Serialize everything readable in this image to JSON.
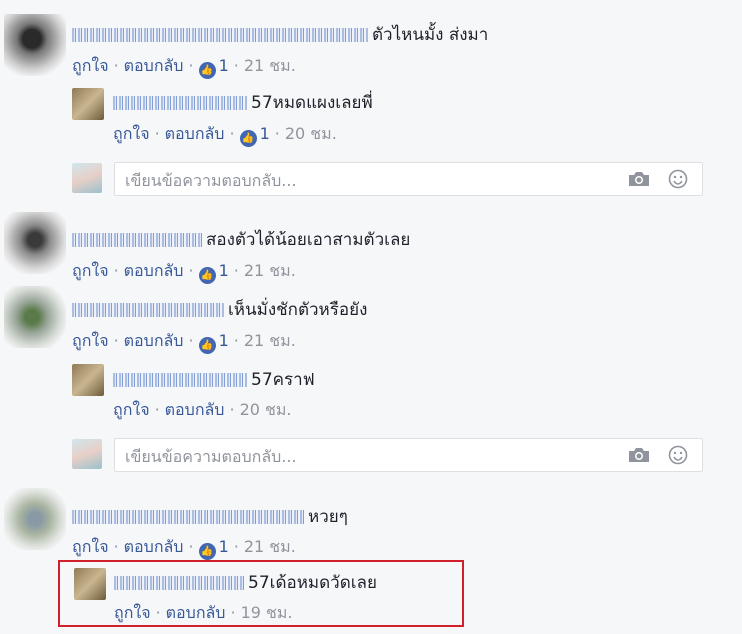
{
  "labels": {
    "like": "ถูกใจ",
    "reply": "ตอบกลับ",
    "separator": "·",
    "like_icon": "thumbs-up-icon"
  },
  "colors": {
    "link": "#385898",
    "meta": "#90949c",
    "like_badge": "#4267b2",
    "highlight": "#d0202c"
  },
  "comments": [
    {
      "text": "ตัวไหนมั้ง ส่งมา",
      "likes": "1",
      "time": "21 ชม."
    },
    {
      "text": "57หมดแผงเลยพี่",
      "likes": "1",
      "time": "20 ชม."
    },
    {
      "text": "สองตัวได้น้อยเอาสามตัวเลย",
      "likes": "1",
      "time": "21 ชม."
    },
    {
      "text": "เห็นมั่งชักตัวหรือยัง",
      "likes": "1",
      "time": "21 ชม."
    },
    {
      "text": "57คราฟ",
      "time": "20 ชม."
    },
    {
      "text": "หวยๆ",
      "likes": "1",
      "time": "21 ชม."
    },
    {
      "text": "57เด้อหมดวัดเลย",
      "time": "19 ชม."
    }
  ],
  "reply_boxes": [
    {
      "placeholder": "เขียนข้อความตอบกลับ..."
    },
    {
      "placeholder": "เขียนข้อความตอบกลับ..."
    }
  ]
}
